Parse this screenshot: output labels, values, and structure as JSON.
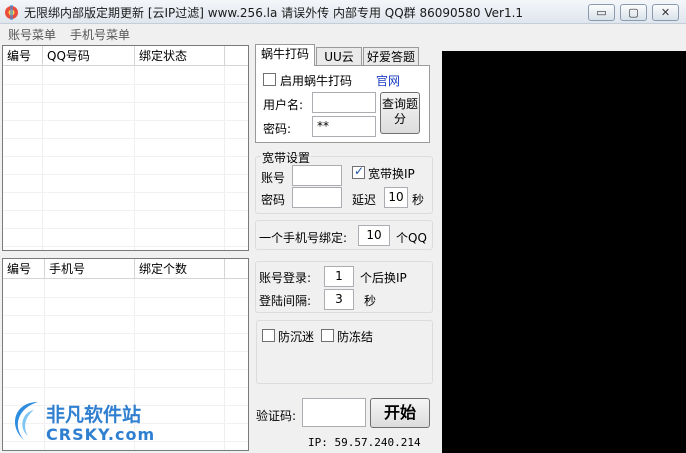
{
  "window": {
    "title": "无限绑内部版定期更新  [云IP过滤]  www.256.la  请误外传 内部专用  QQ群 86090580 Ver1.1",
    "minimize_glyph": "▭",
    "restore_glyph": "▢",
    "close_glyph": "✕"
  },
  "menu": [
    "账号菜单",
    "手机号菜单"
  ],
  "qq_list": {
    "columns": [
      "编号",
      "QQ号码",
      "绑定状态"
    ]
  },
  "phone_list": {
    "columns": [
      "编号",
      "手机号",
      "绑定个数"
    ]
  },
  "tabs": [
    "蜗牛打码",
    "UU云",
    "好爱答题"
  ],
  "captcha": {
    "enable_label": "启用蜗牛打码",
    "official_site_link": "官网",
    "username_label": "用户名:",
    "username_value": "",
    "password_label": "密码:",
    "password_value": "**",
    "query_button": "查询题分"
  },
  "broadband": {
    "group_title": "宽带设置",
    "account_label": "账号",
    "account_value": "",
    "password_label": "密码",
    "password_value": "",
    "switch_ip_label": "宽带换IP",
    "switch_ip_checked": true,
    "delay_label": "延迟",
    "delay_value": "10",
    "delay_unit": "秒"
  },
  "phone_bind": {
    "label": "一个手机号绑定:",
    "value": "10",
    "unit": "个QQ"
  },
  "login": {
    "account_login_label": "账号登录:",
    "account_login_value": "1",
    "account_login_suffix": "个后换IP",
    "interval_label": "登陆间隔:",
    "interval_value": "3",
    "interval_unit": "秒"
  },
  "protect": {
    "anti_addiction_label": "防沉迷",
    "anti_freeze_label": "防冻结"
  },
  "verify": {
    "label": "验证码:",
    "value": "",
    "start_button": "开始"
  },
  "ip_text": "IP: 59.57.240.214",
  "watermark": {
    "brand_cn": "非凡软件站",
    "brand_en": "CRSKY.com"
  },
  "colors": {
    "link": "#1a3dc4",
    "panel_bg": "#f0f0f0",
    "dark_pane": "#000000"
  }
}
